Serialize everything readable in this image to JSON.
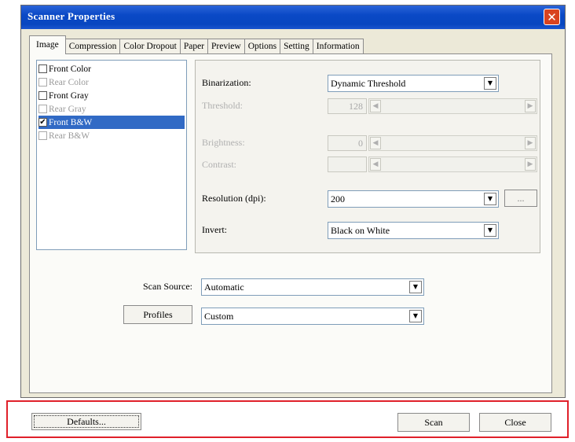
{
  "window": {
    "title": "Scanner Properties",
    "close_glyph": "✕"
  },
  "tabs": [
    "Image",
    "Compression",
    "Color Dropout",
    "Paper",
    "Preview",
    "Options",
    "Setting",
    "Information"
  ],
  "image_list": [
    {
      "label": "Front Color",
      "checked": false,
      "enabled": true,
      "selected": false
    },
    {
      "label": "Rear Color",
      "checked": false,
      "enabled": false,
      "selected": false
    },
    {
      "label": "Front Gray",
      "checked": false,
      "enabled": true,
      "selected": false
    },
    {
      "label": "Rear Gray",
      "checked": false,
      "enabled": false,
      "selected": false
    },
    {
      "label": "Front B&W",
      "checked": true,
      "enabled": true,
      "selected": true
    },
    {
      "label": "Rear B&W",
      "checked": false,
      "enabled": false,
      "selected": false
    }
  ],
  "settings": {
    "binarization": {
      "label": "Binarization:",
      "value": "Dynamic Threshold"
    },
    "threshold": {
      "label": "Threshold:",
      "value": "128"
    },
    "brightness": {
      "label": "Brightness:",
      "value": "0"
    },
    "contrast": {
      "label": "Contrast:",
      "value": ""
    },
    "resolution": {
      "label": "Resolution (dpi):",
      "value": "200",
      "more": "..."
    },
    "invert": {
      "label": "Invert:",
      "value": "Black on White"
    }
  },
  "scan_source": {
    "label": "Scan Source:",
    "value": "Automatic"
  },
  "profiles": {
    "button": "Profiles",
    "value": "Custom"
  },
  "footer": {
    "defaults": "Defaults...",
    "scan": "Scan",
    "close": "Close"
  },
  "glyphs": {
    "dropdown": "▼",
    "left": "◀",
    "right": "▶",
    "check": "✔"
  },
  "colors": {
    "title_bar": "#0a49c6",
    "selection": "#316ac5",
    "highlight_box": "#e0202a"
  }
}
